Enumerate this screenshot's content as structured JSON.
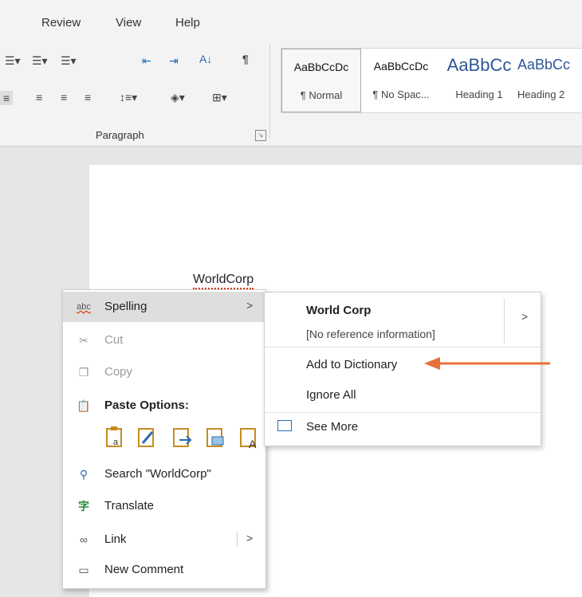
{
  "ribbon": {
    "tabs": [
      "Review",
      "View",
      "Help"
    ],
    "paragraph_group_label": "Paragraph",
    "styles": [
      {
        "preview": "AaBbCcDc",
        "name": "¶ Normal"
      },
      {
        "preview": "AaBbCcDc",
        "name": "¶ No Spac..."
      },
      {
        "preview": "AaBbCc",
        "name": "Heading 1"
      },
      {
        "preview": "AaBbCc",
        "name": "Heading 2"
      }
    ],
    "colors": {
      "heading_blue": "#2f5597"
    }
  },
  "document": {
    "misspelled_word": "WorldCorp"
  },
  "context_menu": {
    "items": [
      {
        "icon": "abc",
        "label": "Spelling",
        "has_submenu": true,
        "highlighted": true
      },
      {
        "icon": "scissors-icon",
        "label": "Cut",
        "disabled": true
      },
      {
        "icon": "copy-icon",
        "label": "Copy",
        "disabled": true
      },
      {
        "icon": "paste-icon",
        "label": "Paste Options:"
      },
      {
        "icon": "search-icon",
        "label": "Search \"WorldCorp\""
      },
      {
        "icon": "translate-icon",
        "label": "Translate"
      },
      {
        "icon": "link-icon",
        "label": "Link",
        "has_submenu": true
      },
      {
        "icon": "comment-icon",
        "label": "New Comment"
      }
    ],
    "paste_options": [
      "keep-source-formatting-icon",
      "merge-formatting-icon",
      "keep-text-only-icon",
      "picture-icon",
      "text-only-icon"
    ]
  },
  "spelling_submenu": {
    "suggestion": "World Corp",
    "reference_info": "[No reference information]",
    "add_to_dictionary": "Add to Dictionary",
    "ignore_all": "Ignore All",
    "see_more": "See More"
  },
  "annotation": {
    "arrow_color": "#e8703a"
  }
}
